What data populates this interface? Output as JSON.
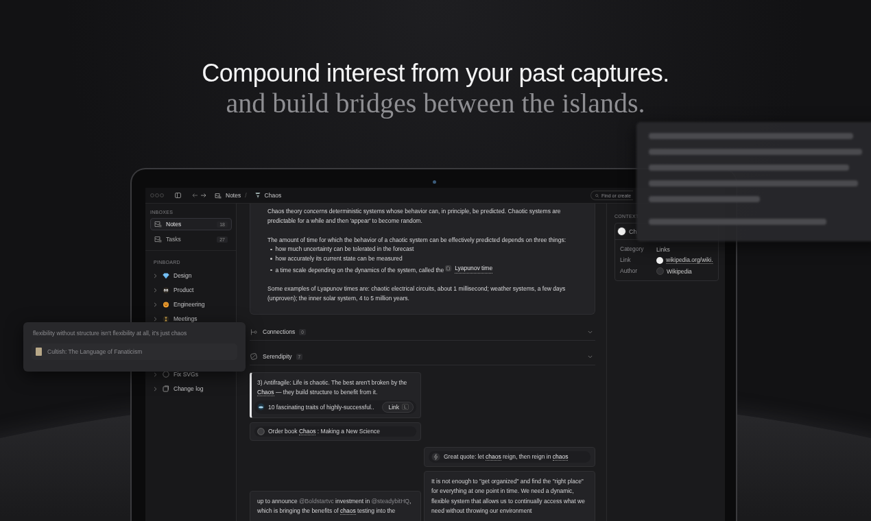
{
  "hero": {
    "headline": "Compound interest from your past captures.",
    "subheadline": "and build bridges between the islands."
  },
  "app": {
    "toolbar": {
      "separator": "/",
      "breadcrumb": [
        {
          "label": "Notes",
          "kind": "inbox"
        },
        {
          "label": "Chaos",
          "kind": "tornado"
        }
      ],
      "search": {
        "placeholder": "Find or create"
      }
    },
    "sidebar": {
      "inboxes": {
        "title": "INBOXES",
        "items": [
          {
            "label": "Notes",
            "count": "18",
            "selected": true
          },
          {
            "label": "Tasks",
            "count": "27",
            "selected": false
          }
        ]
      },
      "pinboard": {
        "title": "PINBOARD",
        "items": [
          {
            "label": "Design",
            "kind": "gem",
            "expanded": false
          },
          {
            "label": "Product",
            "kind": "eyes",
            "expanded": false
          },
          {
            "label": "Engineering",
            "kind": "face",
            "expanded": false
          },
          {
            "label": "Meetings",
            "kind": "hourglass",
            "expanded": false
          },
          {
            "label": "Fix SVGs",
            "kind": "task",
            "expanded": false
          },
          {
            "label": "Change log",
            "kind": "doc",
            "expanded": false
          }
        ]
      }
    },
    "note": {
      "lead": "Chaos theory concerns deterministic systems whose behavior can, in principle, be predicted. Chaotic systems are predictable for a while and then 'appear' to become random.",
      "list_intro": "The amount of time for which the behavior of a chaotic system can be effectively predicted depends on three things:",
      "bullets": [
        {
          "text": "how much uncertainty can be tolerated in the forecast"
        },
        {
          "text": "how accurately its current state can be measured"
        },
        {
          "text": "a time scale depending on the dynamics of the system, called the",
          "link": "Lyapunov time"
        }
      ],
      "closing": "Some examples of Lyapunov times are: chaotic electrical circuits, about 1 millisecond; weather systems, a few days (unproven); the inner solar system, 4 to 5 million years."
    },
    "connections": {
      "label": "Connections",
      "count": "0"
    },
    "serendipity": {
      "label": "Serendipity",
      "count": "7",
      "left_cards": [
        {
          "kind": "quote",
          "selected": true,
          "parts": [
            {
              "kind": "text",
              "text": "3) Antifragile: Life is chaotic. The best aren't broken by the "
            },
            {
              "kind": "tag",
              "text": "Chaos"
            },
            {
              "kind": "text",
              "text": " — they build structure to benefit from it."
            }
          ],
          "source": {
            "title": "10 fascinating traits of highly-successful..",
            "button": "Link",
            "shortcut": "L"
          }
        },
        {
          "kind": "task",
          "selected": false,
          "checked": false,
          "parts": [
            {
              "kind": "text",
              "text": "Order book "
            },
            {
              "kind": "tag",
              "text": "Chaos"
            },
            {
              "kind": "text",
              "text": " : Making a New Science"
            }
          ]
        },
        {
          "kind": "quote",
          "selected": false,
          "parts": [
            {
              "kind": "text",
              "text": "up to announce "
            },
            {
              "kind": "handle",
              "text": "@Boldstartvc"
            },
            {
              "kind": "text",
              "text": " investment in "
            },
            {
              "kind": "handle",
              "text": "@steadybitHQ"
            },
            {
              "kind": "text",
              "text": ", which is bringing the benefits of "
            },
            {
              "kind": "tag",
              "text": "chaos"
            },
            {
              "kind": "text",
              "text": " testing into the"
            }
          ]
        }
      ],
      "right_cards": [
        {
          "kind": "idea",
          "selected": false,
          "parts": [
            {
              "kind": "text",
              "text": "Great quote: let "
            },
            {
              "kind": "tag",
              "text": "chaos"
            },
            {
              "kind": "text",
              "text": " reign, then reign in "
            },
            {
              "kind": "tag",
              "text": "chaos"
            }
          ]
        },
        {
          "kind": "quote",
          "selected": false,
          "parts": [
            {
              "kind": "text",
              "text": "It is not enough to \"get organized\" and find the \"right place\" for everything at one point in time. We need a dynamic, flexible system that allows us to continually access what we need without throwing our environment"
            }
          ]
        }
      ]
    },
    "context": {
      "title": "CONTEXT",
      "card_title": "Ch",
      "properties": [
        {
          "label": "Category",
          "value": "Links",
          "kind": "plain"
        },
        {
          "label": "Link",
          "value": "wikipedia.org/wiki.",
          "kind": "link"
        },
        {
          "label": "Author",
          "value": "Wikipedia",
          "kind": "author"
        }
      ]
    }
  },
  "floating_quote": {
    "text": "flexibility without structure isn't flexibility at all, it's just chaos",
    "source": "Cultish: The Language of Fanaticism"
  }
}
